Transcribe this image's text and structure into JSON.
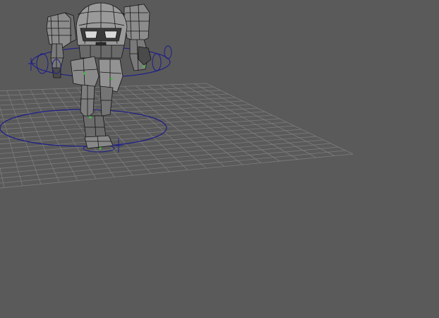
{
  "viewport": {
    "background_color": "#5a5a5a",
    "grid_color": "#7d7d7d",
    "mesh_fill_color": "#8c8c8c",
    "mesh_dark_color": "#3a3a3a",
    "wireframe_color": "#141414",
    "rig_control_color": "#1d1d8a",
    "joint_color": "#4bb84b",
    "grid_divisions": 20
  },
  "scene": {
    "object": "robot-mech-character",
    "display_mode": "wireframe-on-shaded"
  }
}
